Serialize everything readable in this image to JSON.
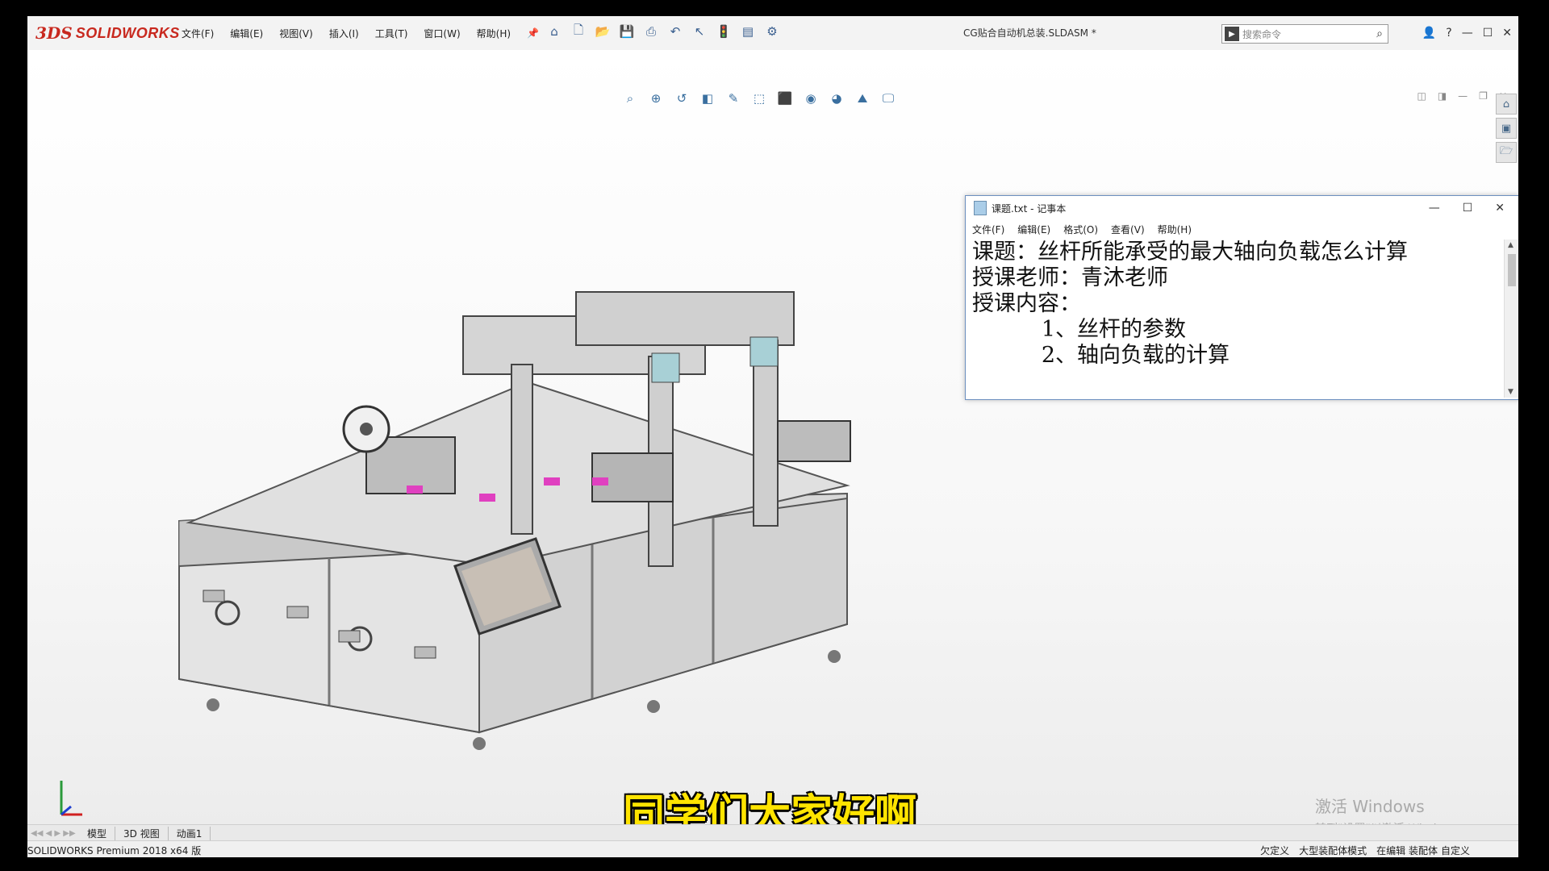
{
  "app": {
    "logo_ds": "3DS",
    "logo_text": "SOLIDWORKS",
    "document_title": "CG贴合自动机总装.SLDASM *",
    "search_placeholder": "搜索命令"
  },
  "menu": [
    "文件(F)",
    "编辑(E)",
    "视图(V)",
    "插入(I)",
    "工具(T)",
    "窗口(W)",
    "帮助(H)"
  ],
  "notepad": {
    "title": "课题.txt - 记事本",
    "menu": [
      "文件(F)",
      "编辑(E)",
      "格式(O)",
      "查看(V)",
      "帮助(H)"
    ],
    "lines": [
      "课题：丝杆所能承受的最大轴向负载怎么计算",
      "授课老师：青沐老师",
      "授课内容：",
      "          1、丝杆的参数",
      "          2、轴向负载的计算"
    ]
  },
  "subtitle": "同学们大家好啊",
  "watermark": {
    "line1": "激活 Windows",
    "line2": "转到\"设置\"以激活 Windows。"
  },
  "tabs": [
    "模型",
    "3D 视图",
    "动画1"
  ],
  "status": {
    "left": "SOLIDWORKS Premium 2018 x64 版",
    "items": [
      "欠定义",
      "大型装配体模式",
      "在编辑 装配体"
    ],
    "custom": "自定义"
  }
}
